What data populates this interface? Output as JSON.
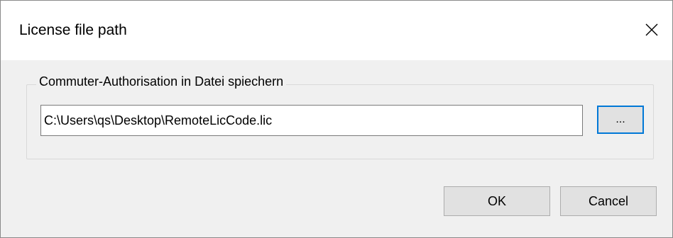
{
  "window": {
    "title": "License file path"
  },
  "group": {
    "label": "Commuter-Authorisation in Datei spiechern",
    "path_value": "C:\\Users\\qs\\Desktop\\RemoteLicCode.lic",
    "browse_label": "..."
  },
  "buttons": {
    "ok_label": "OK",
    "cancel_label": "Cancel"
  },
  "icons": {
    "close": "close-icon"
  },
  "colors": {
    "focus_border": "#0078d7",
    "button_face": "#e1e1e1",
    "window_bg": "#f0f0f0"
  }
}
